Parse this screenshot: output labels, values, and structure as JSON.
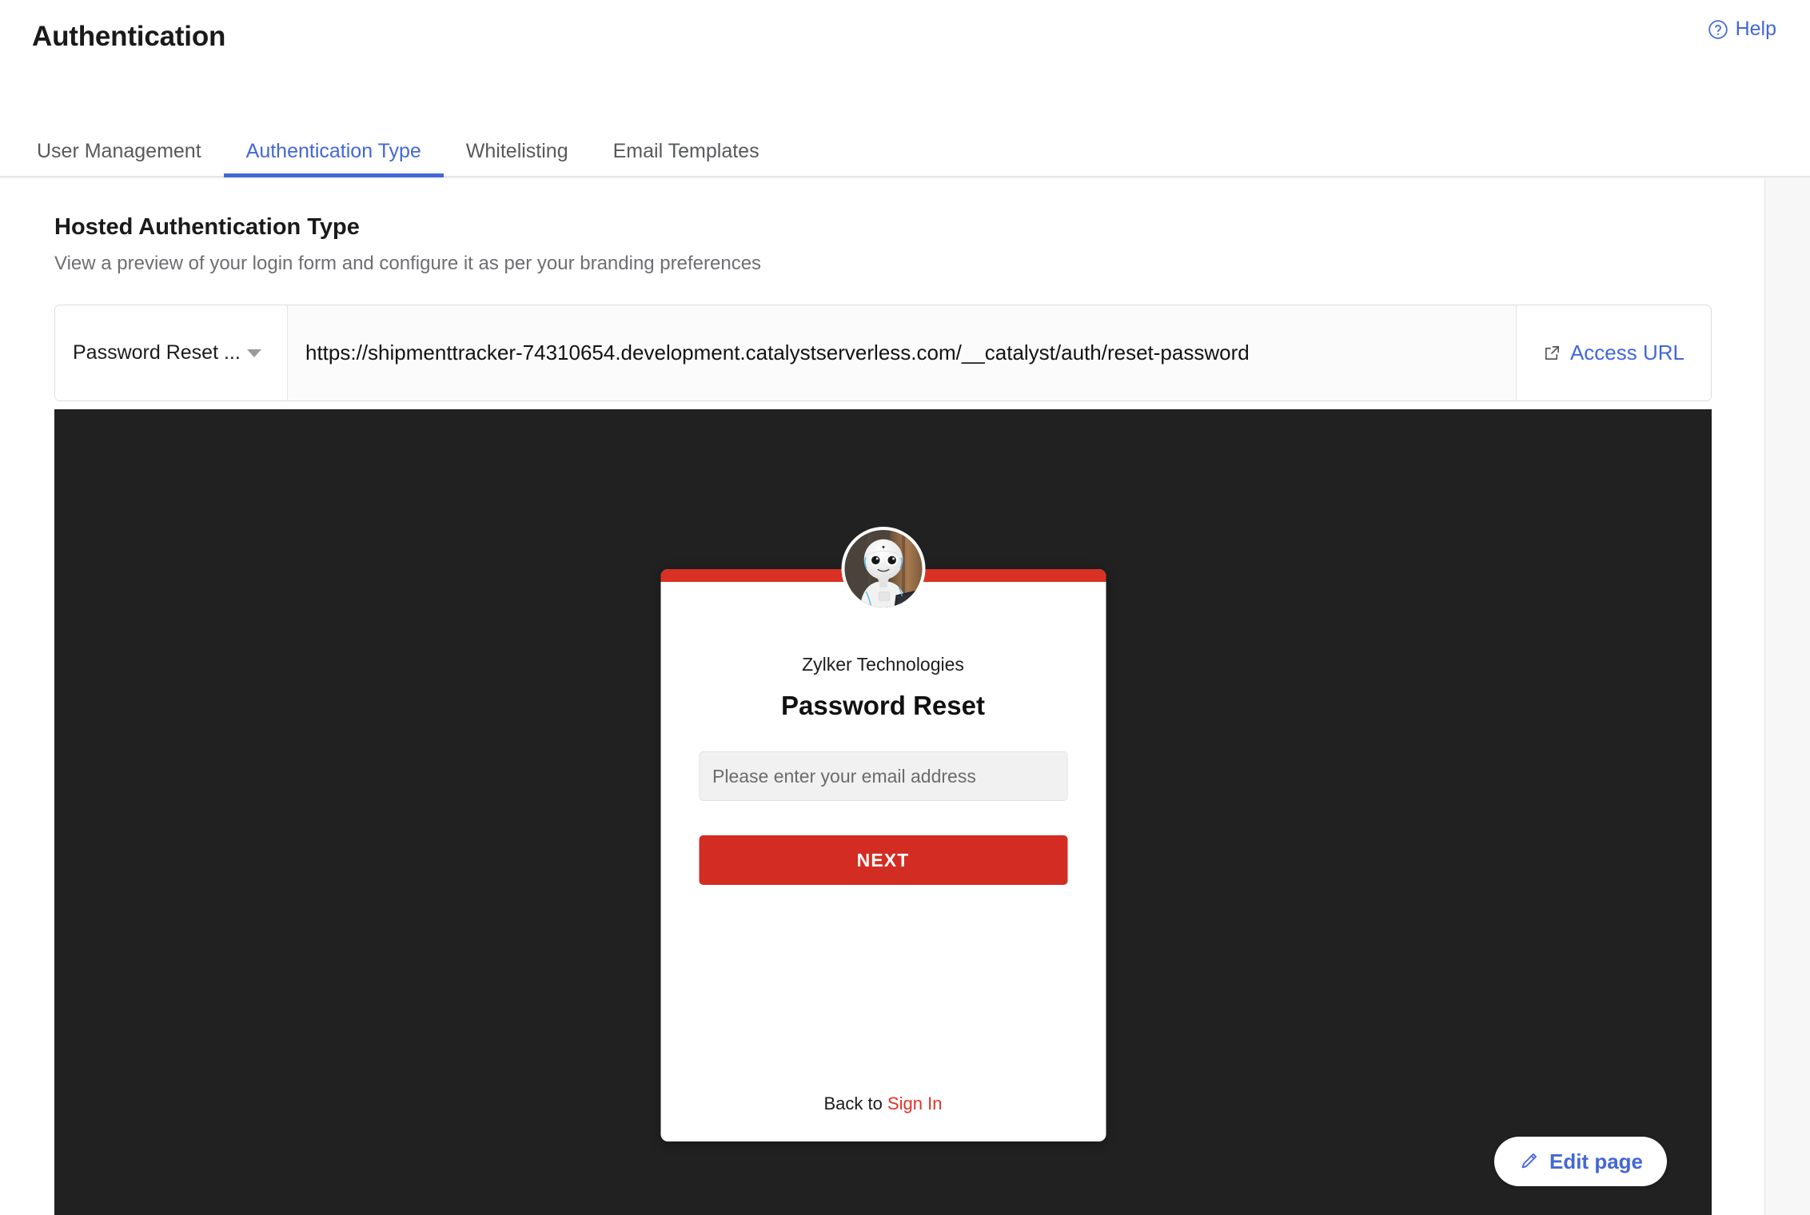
{
  "header": {
    "title": "Authentication",
    "help_label": "Help",
    "help_icon": "question-circle-icon"
  },
  "tabs": [
    {
      "label": "User Management",
      "active": false
    },
    {
      "label": "Authentication Type",
      "active": true
    },
    {
      "label": "Whitelisting",
      "active": false
    },
    {
      "label": "Email Templates",
      "active": false
    }
  ],
  "section": {
    "title": "Hosted Authentication Type",
    "subtitle": "View a preview of your login form and configure it as per your branding preferences"
  },
  "url_bar": {
    "selected_page": "Password Reset ...",
    "dropdown_icon": "chevron-down-icon",
    "url": "https://shipmenttracker-74310654.development.catalystserverless.com/__catalyst/auth/reset-password",
    "access_label": "Access URL",
    "access_icon": "external-link-icon"
  },
  "preview": {
    "background_color": "#212121",
    "accent_color": "#da3125",
    "avatar_icon": "robot-avatar-photo",
    "brand_name": "Zylker Technologies",
    "heading": "Password Reset",
    "email_placeholder": "Please enter your email address",
    "email_value": "",
    "submit_label": "NEXT",
    "back_text": "Back to",
    "signin_label": "Sign In"
  },
  "edit_page": {
    "label": "Edit page",
    "icon": "pencil-icon"
  },
  "colors": {
    "accent_blue": "#4367d6",
    "brand_red": "#d32c22",
    "stage_dark": "#212121"
  }
}
